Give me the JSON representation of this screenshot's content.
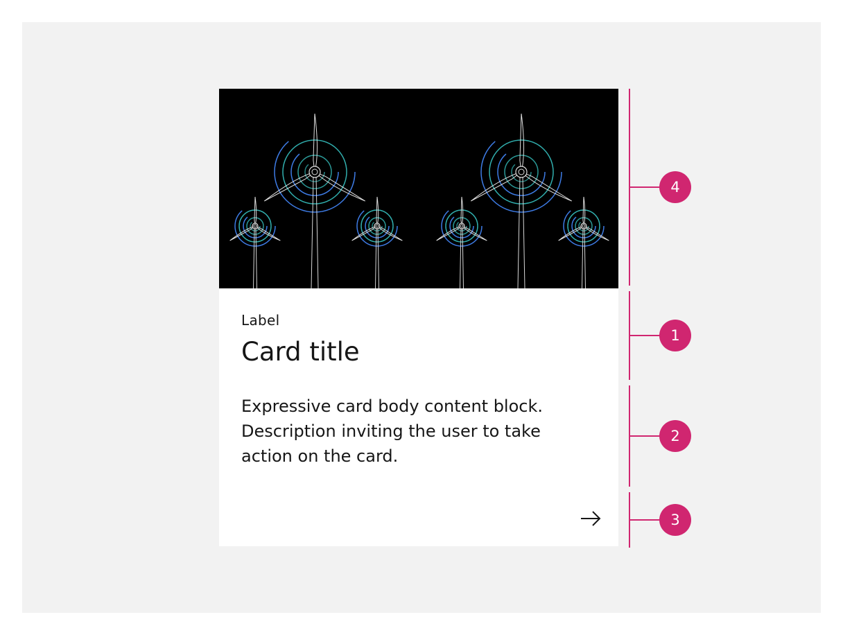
{
  "card": {
    "label": "Label",
    "title": "Card title",
    "body": "Expressive card body content block. Description inviting the user to take action on the card.",
    "cta_icon": "arrow-right-icon",
    "media": "wind-turbines-illustration"
  },
  "annotations": {
    "media_marker": "4",
    "heading_marker": "1",
    "body_marker": "2",
    "action_marker": "3"
  },
  "colors": {
    "annotation": "#d02670",
    "frame_background": "#f2f2f2",
    "card_background": "#ffffff",
    "media_background": "#000000",
    "turbine_blue": "#4589ff",
    "turbine_teal": "#3ddbd9"
  }
}
